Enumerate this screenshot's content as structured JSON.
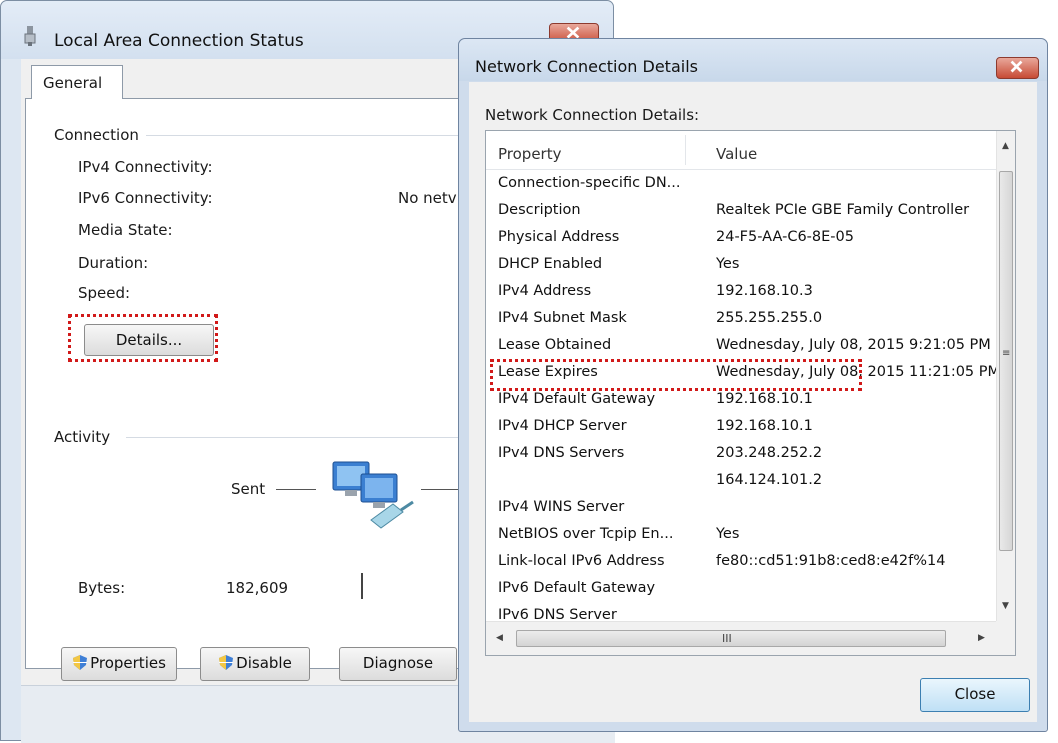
{
  "status_window": {
    "title": "Local Area Connection Status",
    "tab_general": "General",
    "connection_group": "Connection",
    "ipv4_connectivity_label": "IPv4 Connectivity:",
    "ipv6_connectivity_label": "IPv6 Connectivity:",
    "ipv6_connectivity_value": "No netv",
    "media_state_label": "Media State:",
    "duration_label": "Duration:",
    "speed_label": "Speed:",
    "details_button": "Details...",
    "activity_group": "Activity",
    "sent_label": "Sent",
    "bytes_label": "Bytes:",
    "bytes_sent": "182,609",
    "properties_button": "Properties",
    "disable_button": "Disable",
    "diagnose_button": "Diagnose"
  },
  "details_window": {
    "title": "Network Connection Details",
    "list_label": "Network Connection Details:",
    "column_property": "Property",
    "column_value": "Value",
    "rows": [
      {
        "property": "Connection-specific DN...",
        "value": ""
      },
      {
        "property": "Description",
        "value": "Realtek PCIe GBE Family Controller"
      },
      {
        "property": "Physical Address",
        "value": "24-F5-AA-C6-8E-05"
      },
      {
        "property": "DHCP Enabled",
        "value": "Yes"
      },
      {
        "property": "IPv4 Address",
        "value": "192.168.10.3"
      },
      {
        "property": "IPv4 Subnet Mask",
        "value": "255.255.255.0"
      },
      {
        "property": "Lease Obtained",
        "value": "Wednesday, July 08, 2015 9:21:05 PM"
      },
      {
        "property": "Lease Expires",
        "value": "Wednesday, July 08, 2015 11:21:05 PM"
      },
      {
        "property": "IPv4 Default Gateway",
        "value": "192.168.10.1"
      },
      {
        "property": "IPv4 DHCP Server",
        "value": "192.168.10.1"
      },
      {
        "property": "IPv4 DNS Servers",
        "value": "203.248.252.2"
      },
      {
        "property": "",
        "value": "164.124.101.2"
      },
      {
        "property": "IPv4 WINS Server",
        "value": ""
      },
      {
        "property": "NetBIOS over Tcpip En...",
        "value": "Yes"
      },
      {
        "property": "Link-local IPv6 Address",
        "value": "fe80::cd51:91b8:ced8:e42f%14"
      },
      {
        "property": "IPv6 Default Gateway",
        "value": ""
      },
      {
        "property": "IPv6 DNS Server",
        "value": ""
      }
    ],
    "close_button": "Close"
  },
  "colors": {
    "highlight": "#d11919",
    "close_red": "#c74b35",
    "title_bar": "#d3e0ef"
  }
}
